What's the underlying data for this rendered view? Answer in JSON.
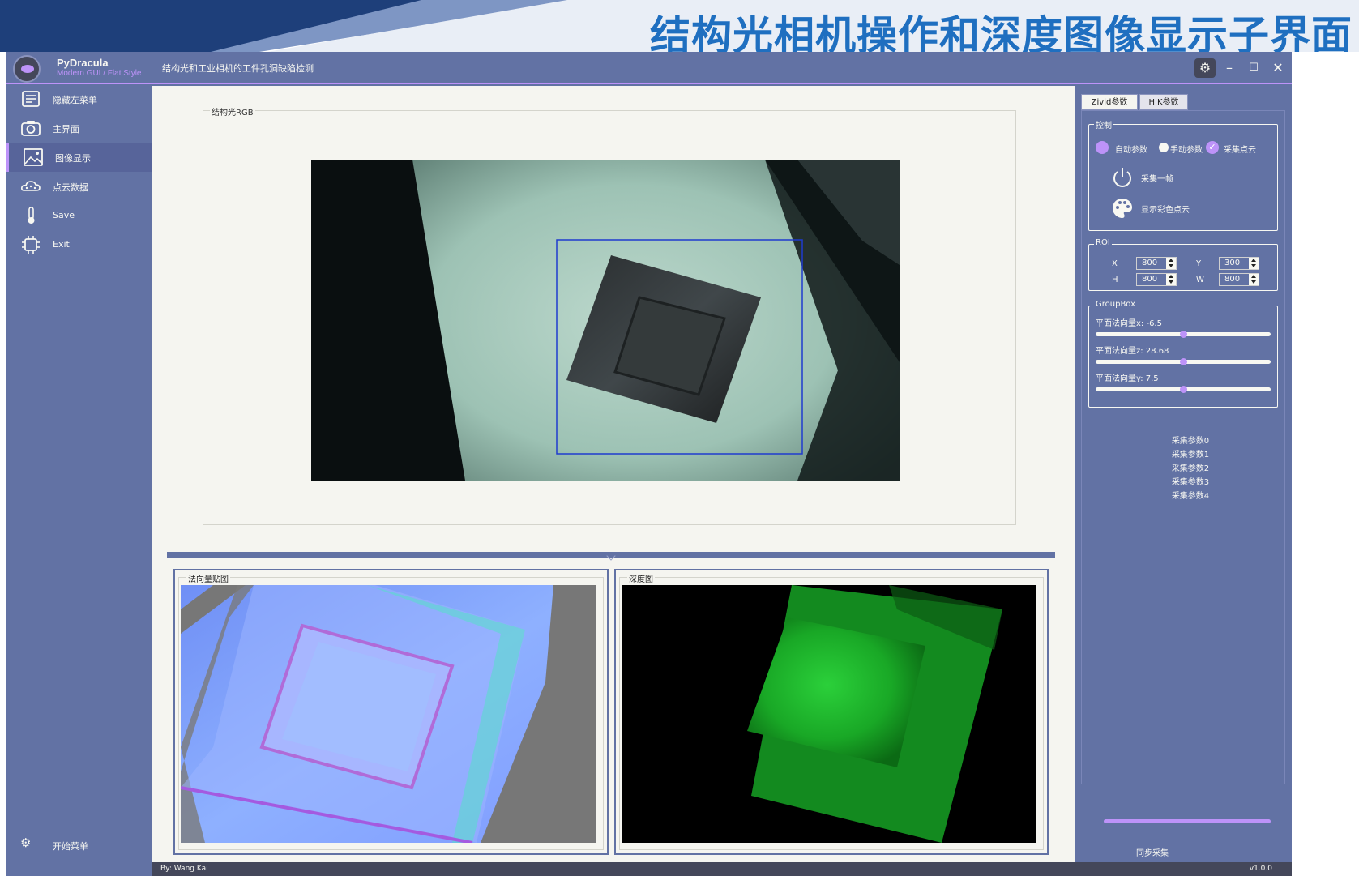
{
  "slide": {
    "title": "结构光相机操作和深度图像显示子界面"
  },
  "app": {
    "name": "PyDracula",
    "description": "Modern GUI / Flat Style",
    "window_title": "结构光和工业相机的工件孔洞缺陷检测",
    "credits": "By: Wang Kai",
    "version": "v1.0.0"
  },
  "menu": {
    "items": [
      {
        "label": "隐藏左菜单",
        "icon": "menu-lines-icon"
      },
      {
        "label": "主界面",
        "icon": "camera-icon"
      },
      {
        "label": "图像显示",
        "icon": "image-icon"
      },
      {
        "label": "点云数据",
        "icon": "cloud-icon"
      },
      {
        "label": "Save",
        "icon": "thermometer-icon"
      },
      {
        "label": "Exit",
        "icon": "chip-icon"
      }
    ],
    "active_index": 2,
    "bottom_label": "开始菜单"
  },
  "content": {
    "rgb_group_title": "结构光RGB",
    "normal_map_title": "法向量贴图",
    "depth_map_title": "深度图"
  },
  "right_panel": {
    "tabs": [
      "Zivid参数",
      "HIK参数"
    ],
    "active_tab": 0,
    "control_group": {
      "title": "控制",
      "auto_label": "自动参数",
      "manual_label": "手动参数",
      "capture_cloud_label": "采集点云",
      "capture_cloud_checked": true,
      "capture_frame_label": "采集一帧",
      "show_color_cloud_label": "显示彩色点云"
    },
    "roi": {
      "title": "ROI",
      "x_label": "X",
      "x_value": "800",
      "y_label": "Y",
      "y_value": "300",
      "h_label": "H",
      "h_value": "800",
      "w_label": "W",
      "w_value": "800"
    },
    "groupbox": {
      "title": "GroupBox",
      "sliders": [
        {
          "label": "平面法向量x: -6.5",
          "level": 0.5
        },
        {
          "label": "平面法向量z: 28.68",
          "level": 0.5
        },
        {
          "label": "平面法向量y: 7.5",
          "level": 0.5
        }
      ]
    },
    "params": [
      "采集参数0",
      "采集参数1",
      "采集参数2",
      "采集参数3",
      "采集参数4"
    ],
    "sync_label": "同步采集"
  },
  "colors": {
    "accent": "#bd93f9",
    "panel": "#6272a4",
    "content_bg": "#f5f5f0",
    "slide_title": "#1f6fc0"
  }
}
